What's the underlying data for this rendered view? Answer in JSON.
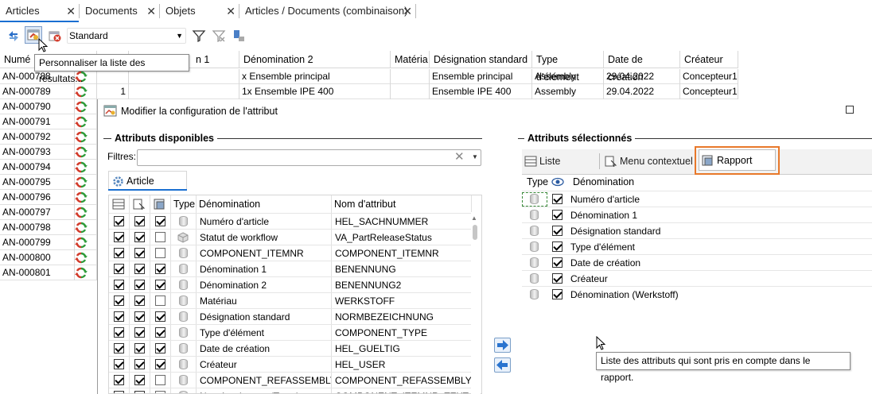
{
  "tabs": [
    {
      "label": "Articles",
      "close": "✕"
    },
    {
      "label": "Documents",
      "close": "✕"
    },
    {
      "label": "Objets",
      "close": "✕"
    },
    {
      "label": "Articles / Documents (combinaison)",
      "close": "✕"
    }
  ],
  "toolbar": {
    "preset_value": "Standard",
    "tooltip": "Personnaliser la liste des résultats...",
    "icons": [
      "refresh-icon",
      "customize-list-icon",
      "delete-icon",
      "filter-icon",
      "clear-filter-icon",
      "settings-icon"
    ]
  },
  "grid": {
    "headers": [
      "Numé",
      "n 1",
      "Dénomination 2",
      "Matéria",
      "Désignation standard",
      "Type d'élément",
      "Date de création",
      "Créateur"
    ],
    "rows": [
      {
        "num": "AN-000788",
        "qty": "",
        "denom2": "x Ensemble principal",
        "mat": "",
        "desig": "Ensemble principal",
        "type": "Assembly",
        "date": "29.04.2022",
        "creator": "Concepteur1"
      },
      {
        "num": "AN-000789",
        "qty": "1",
        "denom2": "1x Ensemble IPE 400",
        "mat": "",
        "desig": "Ensemble IPE 400",
        "type": "Assembly",
        "date": "29.04.2022",
        "creator": "Concepteur1"
      },
      {
        "num": "AN-000790"
      },
      {
        "num": "AN-000791"
      },
      {
        "num": "AN-000792"
      },
      {
        "num": "AN-000793"
      },
      {
        "num": "AN-000794"
      },
      {
        "num": "AN-000795"
      },
      {
        "num": "AN-000796"
      },
      {
        "num": "AN-000797"
      },
      {
        "num": "AN-000798"
      },
      {
        "num": "AN-000799"
      },
      {
        "num": "AN-000800"
      },
      {
        "num": "AN-000801"
      }
    ]
  },
  "dialog": {
    "title": "Modifier la configuration de l'attribut",
    "available": {
      "title": "Attributs disponibles",
      "filter_label": "Filtres:",
      "filter_value": "",
      "tab": "Article",
      "headers": {
        "type": "Type",
        "name": "Dénomination",
        "attr": "Nom d'attribut"
      },
      "rows": [
        {
          "c1": true,
          "c2": true,
          "c3": true,
          "name": "Numéro d'article",
          "attr": "HEL_SACHNUMMER",
          "icon": "cylinder"
        },
        {
          "c1": true,
          "c2": true,
          "c3": false,
          "name": "Statut de workflow",
          "attr": "VA_PartReleaseStatus",
          "icon": "cubes"
        },
        {
          "c1": true,
          "c2": true,
          "c3": false,
          "name": "COMPONENT_ITEMNR",
          "attr": "COMPONENT_ITEMNR",
          "icon": "cylinder"
        },
        {
          "c1": true,
          "c2": true,
          "c3": true,
          "name": "Dénomination 1",
          "attr": "BENENNUNG",
          "icon": "cylinder"
        },
        {
          "c1": true,
          "c2": true,
          "c3": true,
          "name": "Dénomination 2",
          "attr": "BENENNUNG2",
          "icon": "cylinder"
        },
        {
          "c1": true,
          "c2": true,
          "c3": false,
          "name": "Matériau",
          "attr": "WERKSTOFF",
          "icon": "cylinder"
        },
        {
          "c1": true,
          "c2": true,
          "c3": true,
          "name": "Désignation standard",
          "attr": "NORMBEZEICHNUNG",
          "icon": "cylinder"
        },
        {
          "c1": true,
          "c2": true,
          "c3": true,
          "name": "Type d'élément",
          "attr": "COMPONENT_TYPE",
          "icon": "cylinder"
        },
        {
          "c1": true,
          "c2": true,
          "c3": true,
          "name": "Date de création",
          "attr": "HEL_GUELTIG",
          "icon": "cylinder"
        },
        {
          "c1": true,
          "c2": true,
          "c3": true,
          "name": "Créateur",
          "attr": "HEL_USER",
          "icon": "cylinder"
        },
        {
          "c1": true,
          "c2": true,
          "c3": false,
          "name": "COMPONENT_REFASSEMBLY",
          "attr": "COMPONENT_REFASSEMBLY",
          "icon": "cylinder"
        },
        {
          "c1": true,
          "c2": true,
          "c3": false,
          "name": "Numéro de pos. (Texte)",
          "attr": "COMPONENT_ITEMNR_TEXT",
          "icon": "cylinder"
        }
      ]
    },
    "selected": {
      "title": "Attributs sélectionnés",
      "tabs": [
        "Liste",
        "Menu contextuel",
        "Rapport"
      ],
      "headers": {
        "type": "Type",
        "name": "Dénomination"
      },
      "rows": [
        {
          "checked": true,
          "name": "Numéro d'article"
        },
        {
          "checked": true,
          "name": "Dénomination 1"
        },
        {
          "checked": true,
          "name": "Désignation standard"
        },
        {
          "checked": true,
          "name": "Type d'élément"
        },
        {
          "checked": true,
          "name": "Date de création"
        },
        {
          "checked": true,
          "name": "Créateur"
        },
        {
          "checked": true,
          "name": "Dénomination (Werkstoff)"
        }
      ],
      "tooltip": "Liste des attributs qui sont pris en compte dans le rapport."
    }
  },
  "colors": {
    "accent": "#1a6fd1",
    "highlight": "#e8782a",
    "refresh_green": "#2e9b3a",
    "refresh_red": "#d23a2a"
  }
}
